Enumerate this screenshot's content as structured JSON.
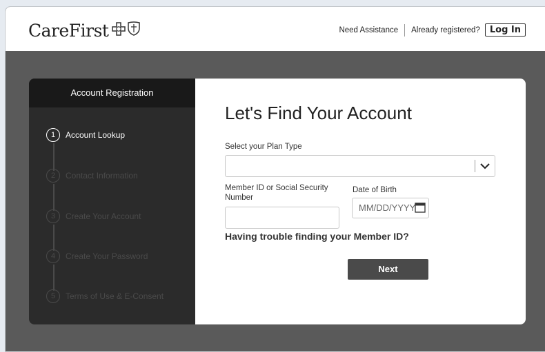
{
  "header": {
    "logo_text": "CareFirst",
    "need_assistance": "Need Assistance",
    "already_registered": "Already registered?",
    "login_label": "Log In"
  },
  "sidebar": {
    "title": "Account Registration",
    "steps": [
      {
        "num": "1",
        "label": "Account Lookup",
        "active": true
      },
      {
        "num": "2",
        "label": "Contact Information",
        "active": false
      },
      {
        "num": "3",
        "label": "Create Your Account",
        "active": false
      },
      {
        "num": "4",
        "label": "Create Your Password",
        "active": false
      },
      {
        "num": "5",
        "label": "Terms of Use & E-Consent",
        "active": false
      }
    ]
  },
  "form": {
    "title": "Let's Find Your Account",
    "plan_type_label": "Select your Plan Type",
    "plan_type_value": "",
    "member_id_label": "Member ID or Social Security Number",
    "member_id_value": "",
    "dob_label": "Date of Birth",
    "dob_placeholder": "MM/DD/YYYY",
    "trouble_link": "Having trouble finding your Member ID?",
    "next_label": "Next"
  }
}
